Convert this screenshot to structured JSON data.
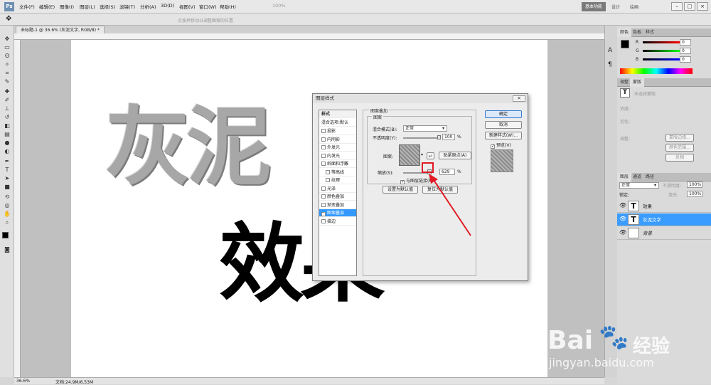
{
  "menubar": {
    "logo": "Ps",
    "items": [
      "文件(F)",
      "编辑(E)",
      "图像(I)",
      "图层(L)",
      "选择(S)",
      "滤镜(T)",
      "分析(A)",
      "3D(D)",
      "视图(V)",
      "窗口(W)",
      "帮助(H)"
    ],
    "zoom": "100%",
    "hint": "点按并移动以调整图案的位置",
    "workspace": "基本功能",
    "ws_tabs": [
      "设计",
      "绘画"
    ]
  },
  "document": {
    "tab_title": "未标题-1 @ 36.6% (灰泥文字, RGB/8) *",
    "zoom_status": "36.6%",
    "doc_size": "文档:24.9M/6.53M"
  },
  "canvas": {
    "text_top": "灰泥",
    "text_bottom": "效果"
  },
  "dialog": {
    "title": "图层样式",
    "styles_header": "样式",
    "blending": "混合选项:默认",
    "effects": [
      {
        "label": "投影",
        "checked": false
      },
      {
        "label": "内阴影",
        "checked": false
      },
      {
        "label": "外发光",
        "checked": false
      },
      {
        "label": "内发光",
        "checked": false
      },
      {
        "label": "斜面和浮雕",
        "checked": false
      },
      {
        "label": "等高线",
        "checked": false
      },
      {
        "label": "纹理",
        "checked": false
      },
      {
        "label": "光泽",
        "checked": false
      },
      {
        "label": "颜色叠加",
        "checked": false
      },
      {
        "label": "渐变叠加",
        "checked": false
      },
      {
        "label": "图案叠加",
        "checked": true
      },
      {
        "label": "描边",
        "checked": false
      }
    ],
    "section_title": "图案叠加",
    "sub_title": "图案",
    "blend_mode_label": "混合模式(B):",
    "blend_mode_value": "正常",
    "opacity_label": "不透明度(Y):",
    "opacity_value": "100",
    "opacity_unit": "%",
    "pattern_label": "图案:",
    "snap_button": "贴紧原点(A)",
    "scale_label": "缩放(S):",
    "scale_value": "629",
    "scale_unit": "%",
    "link_label": "与图层链接(K)",
    "link_checked": true,
    "make_default": "设置为默认值",
    "reset_default": "复位为默认值",
    "ok": "确定",
    "cancel": "取消",
    "new_style": "新建样式(W)...",
    "preview_label": "预览(V)",
    "preview_checked": true
  },
  "panels": {
    "color_tabs": [
      "颜色",
      "色板",
      "样式"
    ],
    "color_rows": [
      {
        "label": "R",
        "value": "0"
      },
      {
        "label": "G",
        "value": "0"
      },
      {
        "label": "B",
        "value": "0"
      }
    ],
    "char_tabs": [
      "调整",
      "蒙版"
    ],
    "char_hint": "未选择蒙版",
    "char_labels": [
      "浓度:",
      "羽化:",
      "调整:"
    ],
    "char_buttons": [
      "蒙版边缘...",
      "颜色范围...",
      "反相"
    ],
    "layer_tabs": [
      "图层",
      "通道",
      "路径"
    ],
    "blend_mode": "正常",
    "opacity_label": "不透明度:",
    "opacity_value": "100%",
    "lock_label": "锁定:",
    "fill_label": "填充:",
    "fill_value": "100%",
    "layers": [
      {
        "name": "效果",
        "type": "T",
        "selected": false
      },
      {
        "name": "灰泥文字",
        "type": "T",
        "selected": true
      },
      {
        "name": "背景",
        "type": "",
        "selected": false
      }
    ]
  },
  "watermark": {
    "brand": "Bai",
    "brand2": "百度",
    "suffix": "经验",
    "url": "jingyan.baidu.com"
  },
  "colors": {
    "accent": "#3399ff",
    "arrow": "#e01b24",
    "selected_layer": "#3a9cff"
  }
}
